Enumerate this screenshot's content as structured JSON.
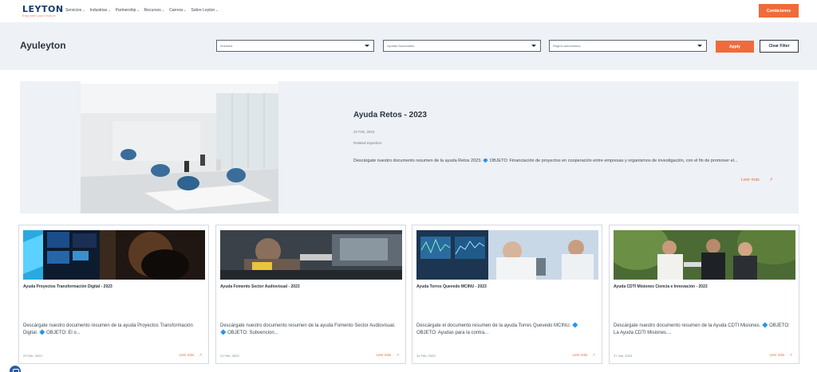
{
  "nav": {
    "logo": "LEYTON",
    "tagline": "Empower your future",
    "menu": [
      {
        "label": "Servicios"
      },
      {
        "label": "Industrias"
      },
      {
        "label": "Partnership"
      },
      {
        "label": "Recursos"
      },
      {
        "label": "Carrera"
      },
      {
        "label": "Sobre Leyton"
      }
    ],
    "contact_label": "Contáctenos"
  },
  "filters": {
    "page_title": "Ayuleyton",
    "industria": "Industria",
    "ayudas": "Ayudas Nacionales",
    "region": "Región autonómica",
    "apply_label": "Apply",
    "clear_label": "Clear Filter"
  },
  "featured": {
    "title": "Ayuda Retos - 2023",
    "date": "22 Feb, 2023",
    "related": "Related expertise:",
    "description": "Descárgate nuestro documento resumen de la ayuda Retos 2023. 🔷 OBJETO: Financiación de proyectos en cooperación entre empresas y organismos de investigación, con el fin de promover el...",
    "more_label": "Leer más",
    "arrow": "↗"
  },
  "cards": [
    {
      "title": "Ayuda Proyectos Transformación Digital - 2023",
      "description": "Descárgate nuestro documento resumen de la ayuda Proyectos Transformación Digital. 🔷 OBJETO: El o...",
      "date": "23 Feb, 2023",
      "more_label": "Leer más",
      "arrow": "↗"
    },
    {
      "title": "Ayuda Fomento Sector Audiovisual - 2023",
      "description": "Descárgate nuestro documento resumen de la ayuda Fomento Sector Audiovisual. 🔷 OBJETO: Subvencion...",
      "date": "21 Feb, 2023",
      "more_label": "Leer más",
      "arrow": "↗"
    },
    {
      "title": "Ayuda Torres Quevedo MCINU - 2023",
      "description": "Descárgate el documento resumen de la ayuda Torres Quevedo MCINU. 🔷 OBJETO: Ayudas para la contra...",
      "date": "31 Feb, 2023",
      "more_label": "Leer más",
      "arrow": "↗"
    },
    {
      "title": "Ayuda CDTI Misiones Ciencia e Innovación - 2023",
      "description": "Descárgate nuestro documento resumen de la Ayuda CDTI Misiones. 🔷 OBJETO: La Ayuda CDTI Misiones....",
      "date": "27 Jan, 2023",
      "more_label": "Leer más",
      "arrow": "↗"
    }
  ],
  "colors": {
    "accent": "#f06b3b",
    "brand": "#1a3a6b",
    "panel": "#eef1f5"
  }
}
